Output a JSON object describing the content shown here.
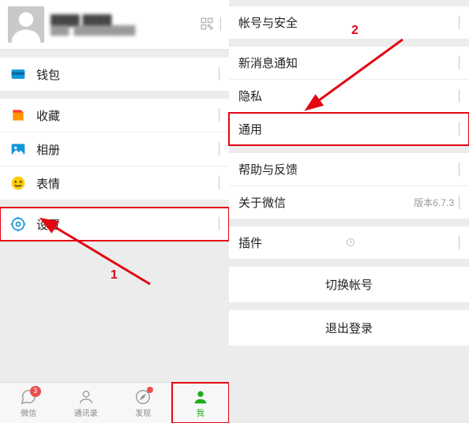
{
  "profile": {
    "name": "████ ████",
    "sub": "███: ██████████"
  },
  "left_menu": {
    "wallet": "钱包",
    "favorites": "收藏",
    "album": "相册",
    "stickers": "表情",
    "settings": "设置"
  },
  "right_menu": {
    "account_security": "帐号与安全",
    "new_msg_notify": "新消息通知",
    "privacy": "隐私",
    "general": "通用",
    "help_feedback": "帮助与反馈",
    "about": "关于微信",
    "plugins": "插件",
    "switch_account": "切换帐号",
    "logout": "退出登录"
  },
  "version_label": "版本6.7.3",
  "tabs": {
    "chat": "微信",
    "contacts": "通讯录",
    "discover": "发现",
    "me": "我"
  },
  "badges": {
    "chat_count": "3"
  },
  "annotations": {
    "step1": "1",
    "step2": "2"
  }
}
